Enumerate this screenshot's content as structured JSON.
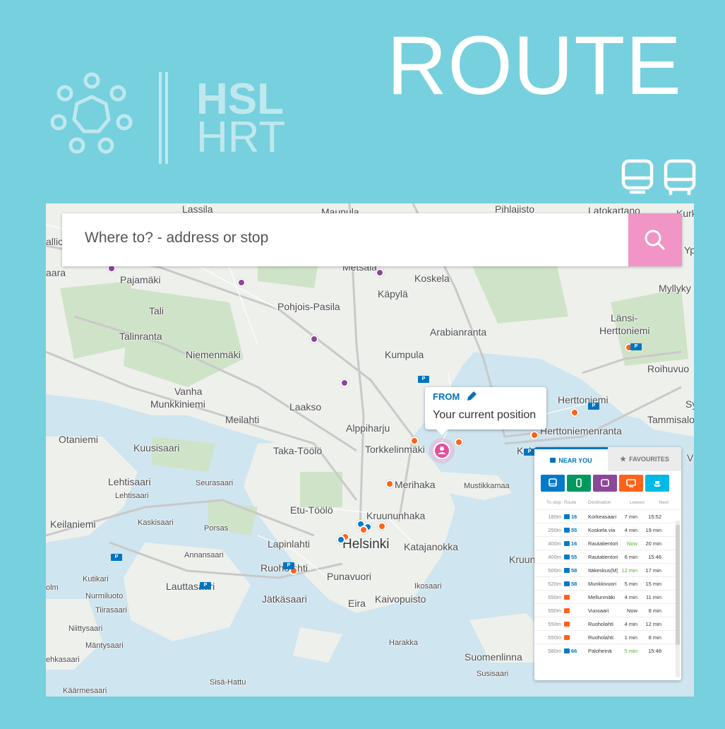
{
  "brand": {
    "line1": "HSL",
    "line2": "HRT"
  },
  "title": "ROUTE",
  "search": {
    "placeholder": "Where to? - address or stop"
  },
  "from_popup": {
    "label": "FROM",
    "text": "Your current position"
  },
  "panel": {
    "tabs": [
      {
        "label": "NEAR YOU",
        "icon": "bus-stop-icon"
      },
      {
        "label": "FAVOURITES",
        "icon": "star-icon"
      }
    ],
    "mode_colors": [
      "#007ac9",
      "#00985f",
      "#8c4799",
      "#ff6319",
      "#00b9e4"
    ],
    "modes": [
      "bus",
      "tram",
      "metro",
      "train",
      "ferry"
    ],
    "columns": {
      "to_stop": "To stop",
      "route": "Route",
      "destination": "Destination",
      "leaves": "Leaves",
      "next": "Next"
    },
    "rows": [
      {
        "dist": "180m",
        "mode": "bus",
        "route": "16",
        "dest": "Korkeasaari",
        "leaves": "7 min",
        "next": "15:52",
        "now": false
      },
      {
        "dist": "250m",
        "mode": "bus",
        "route": "55",
        "dest": "Koskela via",
        "leaves": "4 min",
        "next": "19 min",
        "now": false
      },
      {
        "dist": "400m",
        "mode": "bus",
        "route": "16",
        "dest": "Rautatientori",
        "leaves": "Now",
        "next": "20 min",
        "now": true
      },
      {
        "dist": "400m",
        "mode": "bus",
        "route": "55",
        "dest": "Rautatientori",
        "leaves": "6 min",
        "next": "15:46",
        "now": false
      },
      {
        "dist": "500m",
        "mode": "bus",
        "route": "58",
        "dest": "Itäkeskus(M)",
        "leaves": "12 min",
        "next": "17 min",
        "now": true
      },
      {
        "dist": "520m",
        "mode": "bus",
        "route": "58",
        "dest": "Munkkivuori",
        "leaves": "5 min",
        "next": "15 min",
        "now": false
      },
      {
        "dist": "550m",
        "mode": "train",
        "route": "",
        "dest": "Mellunmäki",
        "leaves": "4 min",
        "next": "11 min",
        "now": false
      },
      {
        "dist": "550m",
        "mode": "train",
        "route": "",
        "dest": "Vuosaari",
        "leaves": "Now",
        "next": "8 min",
        "now": false
      },
      {
        "dist": "550m",
        "mode": "train",
        "route": "",
        "dest": "Ruoholahti",
        "leaves": "4 min",
        "next": "12 min",
        "now": false
      },
      {
        "dist": "550m",
        "mode": "train",
        "route": "",
        "dest": "Ruoholahti",
        "leaves": "1 min",
        "next": "8 min",
        "now": false
      },
      {
        "dist": "580m",
        "mode": "bus",
        "route": "66",
        "dest": "Paloheinä",
        "leaves": "5 min",
        "next": "15:48",
        "now": true
      }
    ]
  },
  "map": {
    "places": [
      "Lassila",
      "Maunula",
      "Pihlajisto",
      "Latokartano",
      "Kurki",
      "allio",
      "Metsälä",
      "Yp",
      "aara",
      "Pajamäki",
      "Koskela",
      "Myllyky",
      "Käpylä",
      "Pohjois-Pasila",
      "Tali",
      "Länsi-",
      "Herttoniemi",
      "Talinranta",
      "Arabianranta",
      "Kumpula",
      "Niemenmäki",
      "Roihuvuo",
      "Vanha",
      "Munkkiniemi",
      "Herttoniemi",
      "Sy",
      "Laakso",
      "Meilahti",
      "Tammisalo",
      "Alppiharju",
      "Herttoniemenranta",
      "Otaniemi",
      "Kuusisaari",
      "Taka-Töölö",
      "Torkkelinmäki",
      "Kulo",
      "V",
      "Lehtisaari",
      "Lehtisaari",
      "Seurasaari",
      "Merihaka",
      "Mustikkamaa",
      "Etu-Töölö",
      "Keilaniemi",
      "Kaskisaari",
      "Kruununhaka",
      "Porsas",
      "Lapinlahti",
      "Helsinki",
      "Katajanokka",
      "Kruunu",
      "Annansaari",
      "Kutikari",
      "Ruoholahti",
      "Punavuori",
      "olm",
      "Lauttasaari",
      "Ikosaari",
      "Nurmiluoto",
      "Jätkäsaari",
      "Eira",
      "Kaivopuisto",
      "Tiirasaari",
      "Niittysaari",
      "Mäntysaari",
      "Harakka",
      "ehkasaari",
      "Suomenlinna",
      "Susisaari",
      "Sisä-Hattu",
      "Käärmesaari"
    ]
  }
}
